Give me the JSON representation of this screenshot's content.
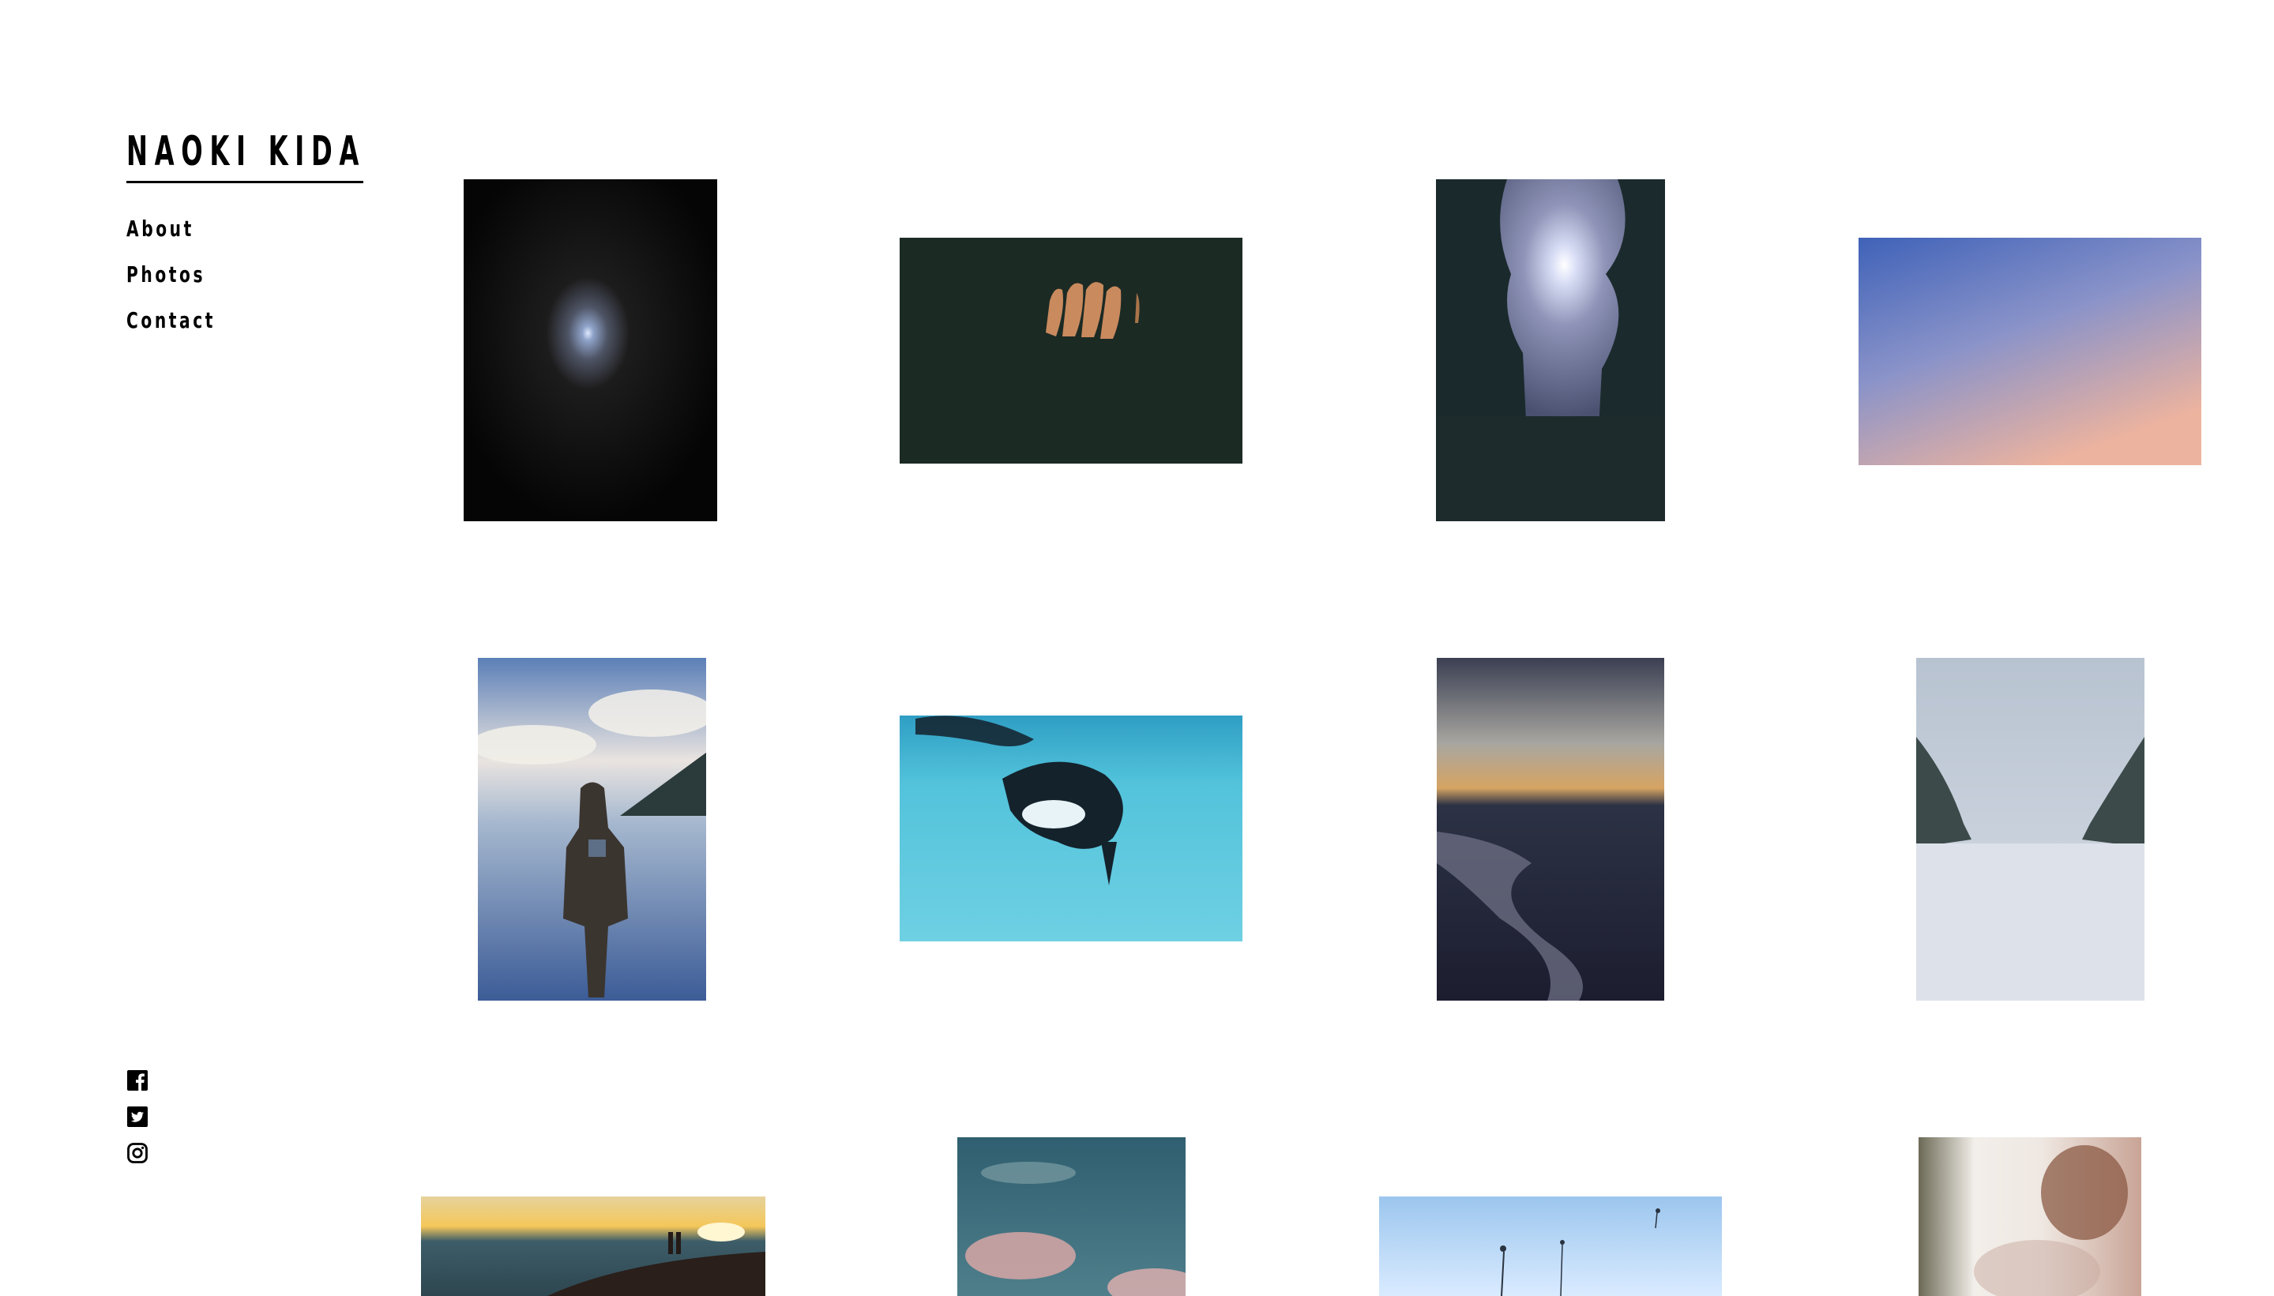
{
  "site": {
    "brand": "NAOKI KIDA"
  },
  "nav": {
    "items": [
      {
        "label": "About"
      },
      {
        "label": "Photos"
      },
      {
        "label": "Contact"
      }
    ]
  },
  "social": [
    {
      "icon": "facebook-icon"
    },
    {
      "icon": "twitter-icon"
    },
    {
      "icon": "instagram-icon"
    }
  ],
  "gallery": {
    "photos": [
      {
        "subject": "moon in night sky",
        "colors": [
          "#070606",
          "#7d8fb2"
        ]
      },
      {
        "subject": "hand in dark",
        "colors": [
          "#1b2b24",
          "#c98a5e"
        ]
      },
      {
        "subject": "sun through trees",
        "colors": [
          "#1a2a2c",
          "#c7d3f2"
        ]
      },
      {
        "subject": "gradient sky",
        "colors": [
          "#3f63b8",
          "#e9b3a2"
        ]
      },
      {
        "subject": "person at lakeside",
        "colors": [
          "#6c86b3",
          "#e9e6e2"
        ]
      },
      {
        "subject": "orca underwater",
        "colors": [
          "#4ec3dc",
          "#0f1a22"
        ]
      },
      {
        "subject": "sunset over tidal river",
        "colors": [
          "#1d2032",
          "#d89a56"
        ]
      },
      {
        "subject": "snowy tree-lined road",
        "colors": [
          "#b9c4d2",
          "#dfe3ea"
        ]
      },
      {
        "subject": "couple on beach at sunset",
        "colors": [
          "#f1c45b",
          "#2f4b56"
        ]
      },
      {
        "subject": "pink clouds in teal sky",
        "colors": [
          "#3f6c7a",
          "#e0a6a6"
        ]
      },
      {
        "subject": "plants in snow",
        "colors": [
          "#a9cdf0",
          "#eef6ff"
        ]
      },
      {
        "subject": "blurred person at window",
        "colors": [
          "#f1eeea",
          "#9a5b3e"
        ]
      }
    ]
  }
}
